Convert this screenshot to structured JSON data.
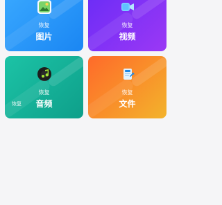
{
  "tiles": [
    {
      "key": "pictures",
      "restore_label": "恢复",
      "title": "图片",
      "icon": "image-icon",
      "colors": {
        "from": "#3aa9ff",
        "to": "#1a86f3"
      }
    },
    {
      "key": "videos",
      "restore_label": "恢复",
      "title": "视频",
      "icon": "video-camera-icon",
      "colors": {
        "from": "#6a2cf6",
        "to": "#9b38f5"
      }
    },
    {
      "key": "audio",
      "restore_label": "恢复",
      "title": "音频",
      "secondary_label": "恢复",
      "icon": "music-note-icon",
      "colors": {
        "from": "#1cc3a6",
        "to": "#0e9f8a"
      }
    },
    {
      "key": "files",
      "restore_label": "恢复",
      "title": "文件",
      "icon": "document-icon",
      "colors": {
        "from": "#ff6a2a",
        "to": "#f3b32b"
      }
    }
  ]
}
